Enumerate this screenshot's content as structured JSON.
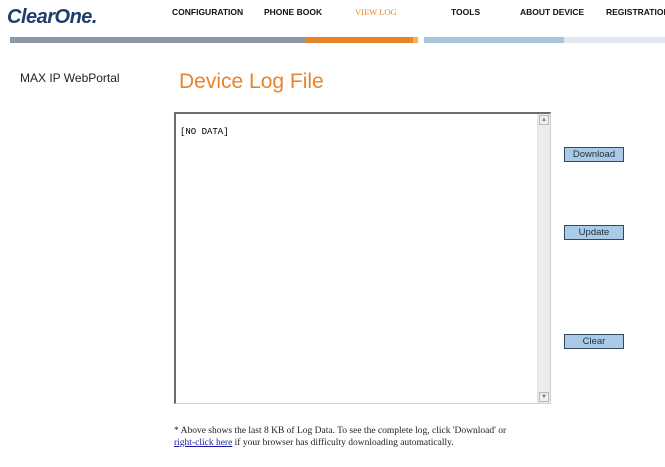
{
  "brand": {
    "logo_text": "ClearOne."
  },
  "nav": {
    "items": [
      {
        "label": "CONFIGURATION"
      },
      {
        "label": "PHONE BOOK"
      },
      {
        "label": "VIEW LOG"
      },
      {
        "label": "TOOLS"
      },
      {
        "label": "ABOUT DEVICE"
      },
      {
        "label": "REGISTRATION"
      }
    ],
    "active": "VIEW LOG"
  },
  "colors": {
    "accent": "#e8842b",
    "bar_gray": "#8a97a4",
    "bar_light_blue": "#a9c4dd",
    "button_fill": "#a9cbe8",
    "logo_blue": "#1f3d6e"
  },
  "sidebar": {
    "product": "MAX IP WebPortal"
  },
  "main": {
    "title": "Device Log File",
    "log_text": "[NO DATA]",
    "buttons": {
      "download": "Download",
      "update": "Update",
      "clear": "Clear"
    },
    "note": {
      "before_link": "* Above shows the last 8 KB of Log Data. To see the complete log, click 'Download' or ",
      "link": "right-click here",
      "after_link": " if your browser has difficulty downloading automatically."
    }
  }
}
